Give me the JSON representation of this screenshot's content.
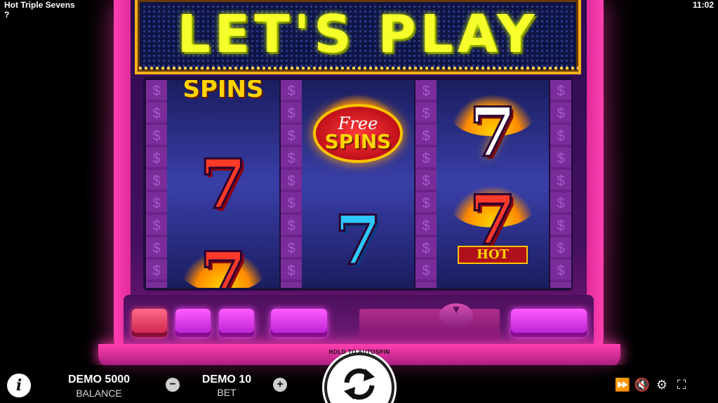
{
  "app": {
    "title": "Hot Triple Sevens",
    "help": "?",
    "clock": "11:02"
  },
  "marquee": {
    "text": "LET'S PLAY"
  },
  "reels": {
    "divider_glyph": "$",
    "reel1": {
      "top": "SPINS",
      "middle": "7",
      "bottom": "7"
    },
    "reel2": {
      "top_line1": "Free",
      "top_line2": "SPINS",
      "middle": "7"
    },
    "reel3": {
      "top": "7",
      "middle": "7",
      "middle_banner": "HOT"
    }
  },
  "bottom_bar": {
    "info_label": "i",
    "balance_value": "DEMO 5000",
    "balance_label": "BALANCE",
    "minus_label": "−",
    "bet_value": "DEMO 10",
    "bet_label": "BET",
    "plus_label": "+",
    "spin_hint": "HOLD TO AUTOSPIN"
  },
  "controls": {
    "turbo": "⏩",
    "sound": "🔇",
    "settings": "⚙",
    "fullscreen": "⛶"
  },
  "colors": {
    "marquee_text": "#f6ff2a",
    "accent_pink": "#ff3fb0",
    "button_magenta": "#d936e8"
  }
}
